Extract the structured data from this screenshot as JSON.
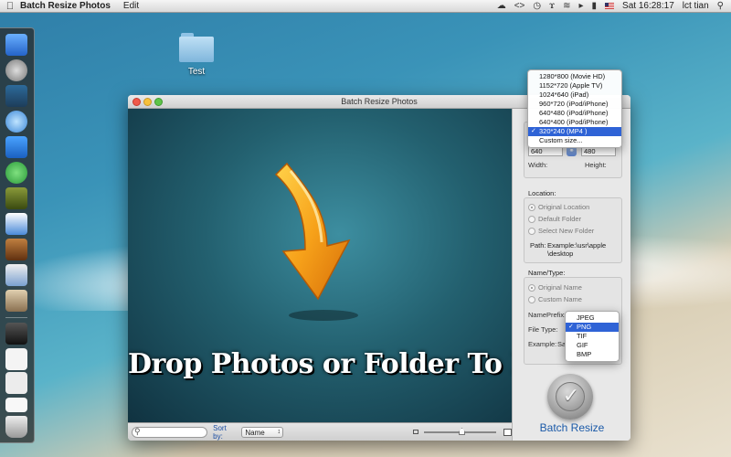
{
  "menubar": {
    "app_name": "Batch Resize Photos",
    "menus": [
      "Edit"
    ],
    "clock": "Sat 16:28:17",
    "user": "lct tian"
  },
  "desktop": {
    "folder_label": "Test"
  },
  "window": {
    "title": "Batch Resize Photos",
    "drop_text": "Drop Photos or Folder To Here",
    "search_placeholder": "",
    "sort_label": "Sort by:",
    "sort_value": "Name"
  },
  "size": {
    "width_value": "640",
    "height_value": "480",
    "width_label": "Width:",
    "height_label": "Height:",
    "options": [
      "1280*800 (Movie HD)",
      "1152*720 (Apple TV)",
      "1024*640 (iPad)",
      "960*720 (iPod/iPhone)",
      "640*480 (iPod/iPhone)",
      "640*400 (iPod/iPhone)",
      "320*240 (MP4 )",
      "Custom size..."
    ],
    "selected_index": 6
  },
  "location": {
    "label": "Location:",
    "options": [
      "Original Location",
      "Default Folder",
      "Select New Folder"
    ],
    "path_label": "Path:",
    "path_value_line1": "Example:\\usr\\apple",
    "path_value_line2": "\\desktop"
  },
  "nametype": {
    "label": "Name/Type:",
    "options": [
      "Original Name",
      "Custom Name"
    ],
    "name_prefix_label": "NamePrefix:",
    "file_type_label": "File Type:",
    "example_label": "Example:",
    "example_value": "Sa",
    "file_types": [
      "JPEG",
      "PNG",
      "TIF",
      "GIF",
      "BMP"
    ],
    "selected_file_type_index": 1
  },
  "batch_resize_label": "Batch Resize",
  "colors": {
    "accent": "#2f63d6",
    "batch_label": "#1b5aa8",
    "drop_area": "#23606f"
  }
}
